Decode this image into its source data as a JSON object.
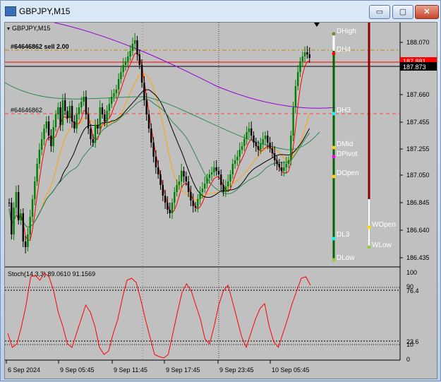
{
  "window": {
    "title": "GBPJPY,M15",
    "minimize": "▭",
    "maximize": "▢",
    "close": "✕"
  },
  "chart": {
    "symbol_label": "GBPJPY,M15",
    "order_label": "#64646862 sell 2.00",
    "order_label_2": "#64646862",
    "price_axis": [
      "188.070",
      "187.660",
      "187.455",
      "187.255",
      "187.050",
      "186.845",
      "186.640",
      "186.435"
    ],
    "current_price": "187.873",
    "current_price_behind": "187.881",
    "levels": [
      "DHigh",
      "DH4",
      "DH3",
      "DMid",
      "DPivot",
      "DOpen",
      "DL3",
      "DLow",
      "WOpen",
      "WLow"
    ],
    "time_axis": [
      "6 Sep 2024",
      "9 Sep 05:45",
      "9 Sep 11:45",
      "9 Sep 17:45",
      "9 Sep 23:45",
      "10 Sep 05:45"
    ]
  },
  "stoch": {
    "label": "Stoch(14,3,3) 89.0610 91.1569",
    "axis": [
      "100",
      "90",
      "76.4",
      "23.6",
      "10",
      "0"
    ]
  },
  "colors": {
    "bull": "#008000",
    "bear": "#000000",
    "ma_red": "#ff0000",
    "ma_orange": "#ffa500",
    "ma_purple": "#9400d3",
    "ma_teal": "#2e8b57",
    "stoch": "#ff0000"
  }
}
